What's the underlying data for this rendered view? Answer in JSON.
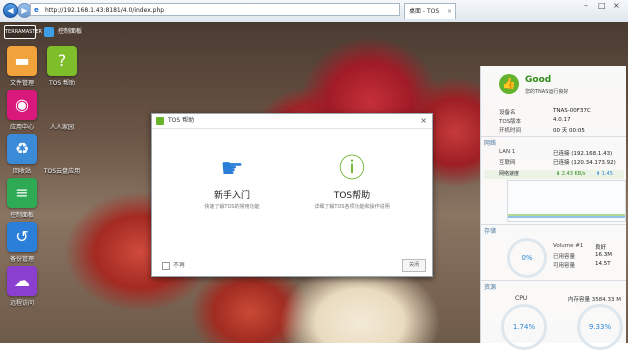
{
  "browser": {
    "address": "http://192.168.1.43:8181/4.0/index.php",
    "tab_label": "桌面 - TOS",
    "tab_close": "×",
    "tab_new": "×",
    "win_min": "–",
    "win_max": "□",
    "win_close": "×",
    "back_glyph": "◀",
    "fwd_glyph": "▶"
  },
  "taskbar": {
    "logo": "TERRAMASTER",
    "control_panel": "控制面板"
  },
  "desktop_icons": [
    {
      "label": "文件管理",
      "color": "#f2a23a",
      "glyph": "▬"
    },
    {
      "label": "TOS 帮助",
      "color": "#7dbe2a",
      "glyph": "?"
    },
    {
      "label": "应用中心",
      "color": "#d9187b",
      "glyph": "◉"
    },
    {
      "label": "人人家园",
      "color": "#d9187b",
      "glyph": ""
    },
    {
      "label": "回收站",
      "color": "#3a8ad8",
      "glyph": "♻"
    },
    {
      "label": "TOS云盘应用",
      "color": "#d9187b",
      "glyph": ""
    },
    {
      "label": "控制面板",
      "color": "#2eaa55",
      "glyph": "≡"
    },
    {
      "label": "备份管理",
      "color": "#2b7fd9",
      "glyph": "↺"
    },
    {
      "label": "远程访问",
      "color": "#8a3fd0",
      "glyph": "☁"
    }
  ],
  "dialog": {
    "title": "TOS 帮助",
    "close": "×",
    "option1": {
      "title": "新手入门",
      "sub": "快速了解TOS的常用功能",
      "icon": "pointing-hand-icon"
    },
    "option2": {
      "title": "TOS帮助",
      "sub": "详细了解TOS各项功能和操作说明",
      "icon": "info-icon"
    },
    "dont_show": "不再",
    "close_btn": "关闭",
    "accent": "#6ab42d"
  },
  "status_panel": {
    "good_title": "Good",
    "good_sub": "您的TNAS运行良好",
    "device": [
      {
        "k": "设备名",
        "v": "TNAS-00F37C"
      },
      {
        "k": "TOS版本",
        "v": "4.0.17"
      },
      {
        "k": "开机时间",
        "v": "00 天 00:05"
      }
    ],
    "network_title": "网络",
    "network": [
      {
        "k": "LAN 1",
        "v": "已连接 (192.168.1.43)"
      },
      {
        "k": "互联网",
        "v": "已连接 (120.34.173.92)"
      }
    ],
    "speed_label": "网络速度",
    "down_speed": "2.43 KB/s",
    "up_speed": "1.45 KB/s",
    "storage_title": "存储",
    "storage_pct": "0%",
    "volume_name": "Volume #1",
    "volume_status": "良好",
    "used_label": "已用容量",
    "used_value": "16.3M",
    "avail_label": "可用容量",
    "avail_value": "14.5T",
    "resource_title": "资源",
    "cpu_label": "CPU",
    "cpu_pct": "1.74%",
    "mem_label": "内存容量 3584.33 M",
    "mem_pct": "9.33%"
  }
}
